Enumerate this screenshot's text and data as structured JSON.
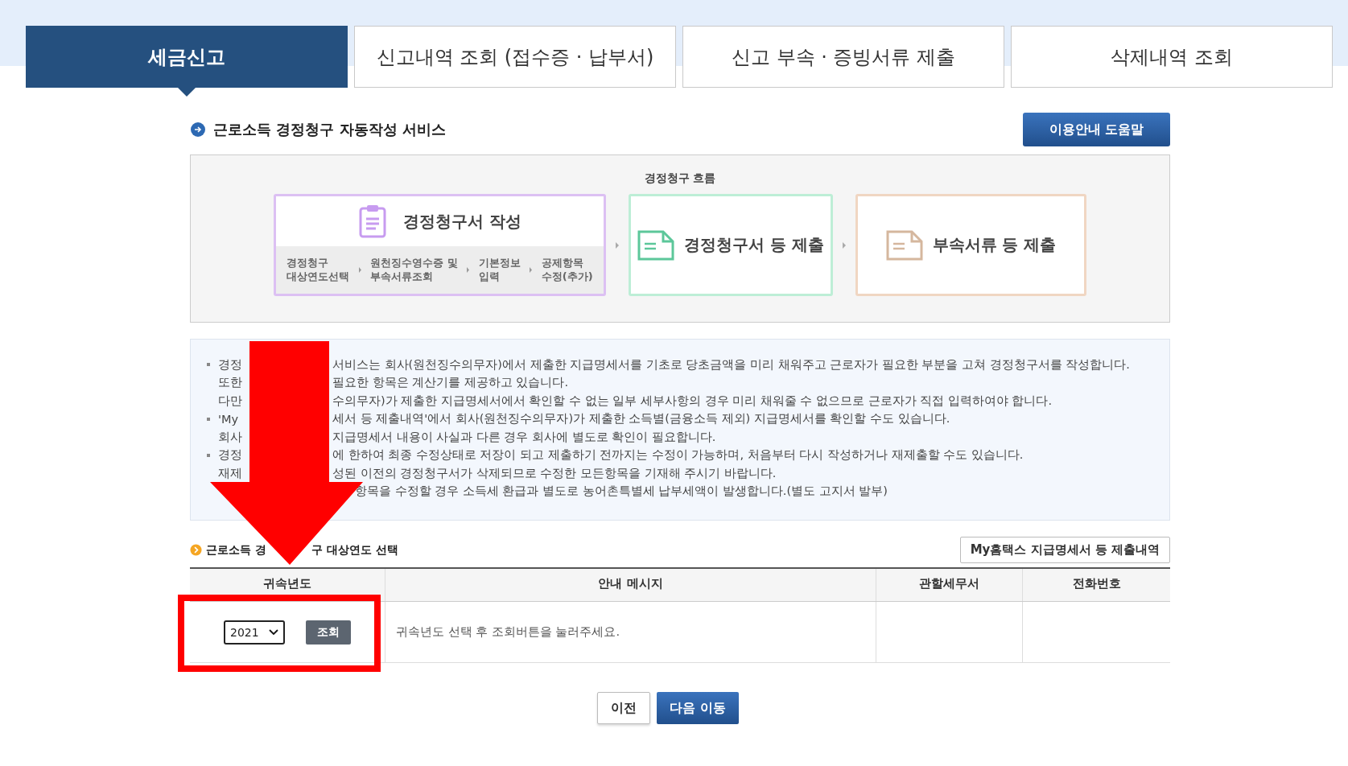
{
  "tabs": [
    {
      "label": "세금신고",
      "selected": true
    },
    {
      "label": "신고내역 조회 (접수증 · 납부서)",
      "selected": false
    },
    {
      "label": "신고 부속 · 증빙서류 제출",
      "selected": false
    },
    {
      "label": "삭제내역 조회",
      "selected": false
    }
  ],
  "service": {
    "title": "근로소득 경정청구 자동작성 서비스",
    "help_button": "이용안내 도움말"
  },
  "flow": {
    "title": "경정청구 흐름",
    "steps": [
      {
        "kind": "write",
        "title": "경정청구서 작성",
        "substeps": [
          [
            "경정청구",
            "대상연도선택"
          ],
          [
            "원천징수영수증 및",
            "부속서류조회"
          ],
          [
            "기본정보",
            "입력"
          ],
          [
            "공제항목",
            "수정(추가)"
          ]
        ]
      },
      {
        "kind": "submit",
        "title": "경정청구서 등 제출"
      },
      {
        "kind": "attach",
        "title": "부속서류 등 제출"
      }
    ]
  },
  "notes": [
    {
      "kind": "split",
      "bullet": true,
      "head": "경정",
      "tail": "서비스는 회사(원천징수의무자)에서 제출한 지급명세서를 기초로 당초금액을 미리 채워주고 근로자가 필요한 부분을 고쳐 경정청구서를 작성합니다."
    },
    {
      "kind": "split",
      "bullet": false,
      "head": "또한",
      "tail": "필요한 항목은 계산기를 제공하고 있습니다."
    },
    {
      "kind": "split",
      "bullet": false,
      "head": "다만",
      "tail": "수의무자)가 제출한 지급명세서에서 확인할 수 없는 일부 세부사항의 경우 미리 채워줄 수 없으므로 근로자가 직접 입력하여야 합니다."
    },
    {
      "kind": "split",
      "bullet": true,
      "head": "'My",
      "tail": "세서 등 제출내역'에서 회사(원천징수의무자)가 제출한 소득별(금융소득 제외) 지급명세서를 확인할 수도 있습니다."
    },
    {
      "kind": "split",
      "bullet": false,
      "head": "회사",
      "tail": "지급명세서 내용이 사실과 다른 경우 회사에 별도로 확인이 필요합니다."
    },
    {
      "kind": "split",
      "bullet": true,
      "head": "경정",
      "tail": "에 한하여 최종 수정상태로 저장이 되고 제출하기 전까지는 수정이 가능하며, 처음부터 다시 작성하거나 재제출할 수도 있습니다."
    },
    {
      "kind": "split",
      "bullet": false,
      "head": "재제",
      "tail": "성된 이전의 경정청구서가 삭제되므로 수정한 모든항목을 기재해 주시기 바랍니다."
    },
    {
      "kind": "covered",
      "bullet": false,
      "tail": "항목을 수정할 경우 소득세 환급과 별도로 농어촌특별세 납부세액이 발생합니다.(별도 고지서 발부)"
    }
  ],
  "year_section": {
    "title_head": "근로소득 경",
    "title_tail": "구 대상연도 선택",
    "records_button": "My홈택스 지급명세서 등 제출내역"
  },
  "table": {
    "columns": [
      "귀속년도",
      "안내 메시지",
      "관할세무서",
      "전화번호"
    ],
    "row": {
      "year": "2021",
      "query_button": "조회",
      "message": "귀속년도 선택 후 조회버튼을 눌러주세요."
    }
  },
  "buttons": {
    "prev": "이전",
    "next": "다음 이동"
  }
}
